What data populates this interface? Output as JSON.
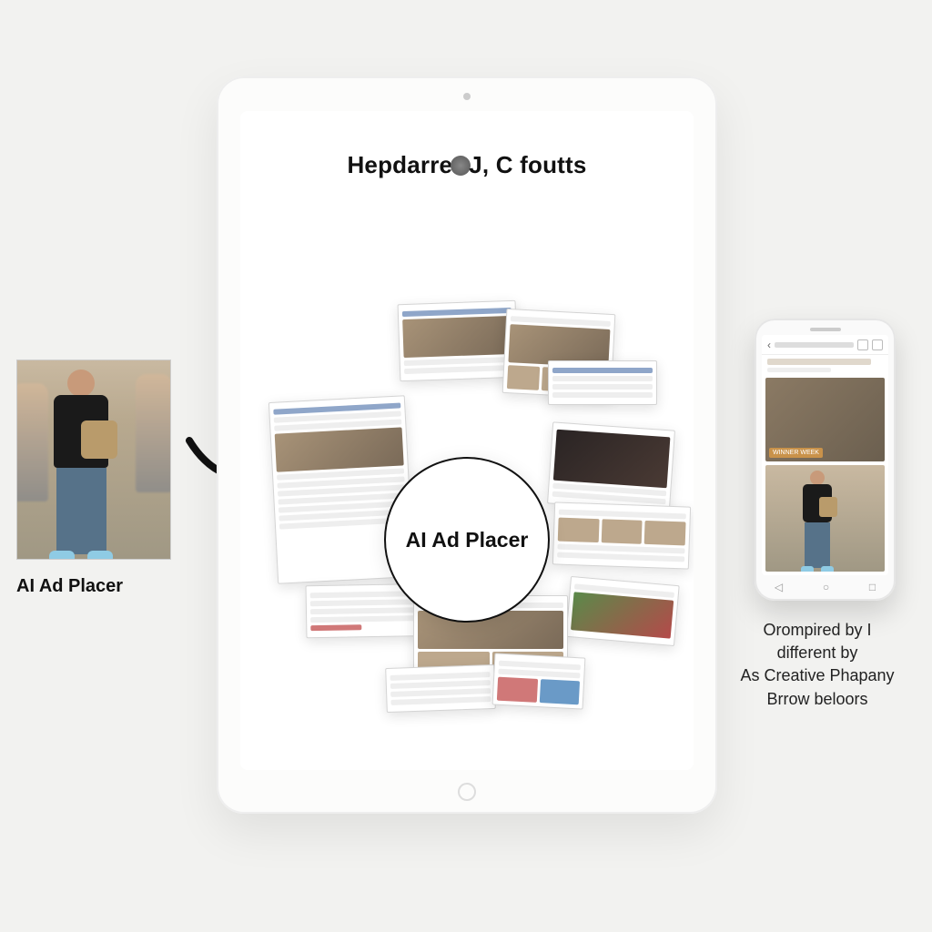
{
  "source": {
    "caption": "AI Ad Placer"
  },
  "tablet": {
    "headline_left": "Hepdarre",
    "headline_right": "J, C foutts",
    "badge": "AI Ad Placer"
  },
  "phone": {
    "image_tag": "WINNER WEEK",
    "caption_lines": [
      "Orompired by I",
      "different by",
      "As Creative Phapany",
      "Brrow beloors"
    ]
  },
  "icons": {
    "arrow": "arrow-right-curved",
    "globe": "globe-icon"
  }
}
